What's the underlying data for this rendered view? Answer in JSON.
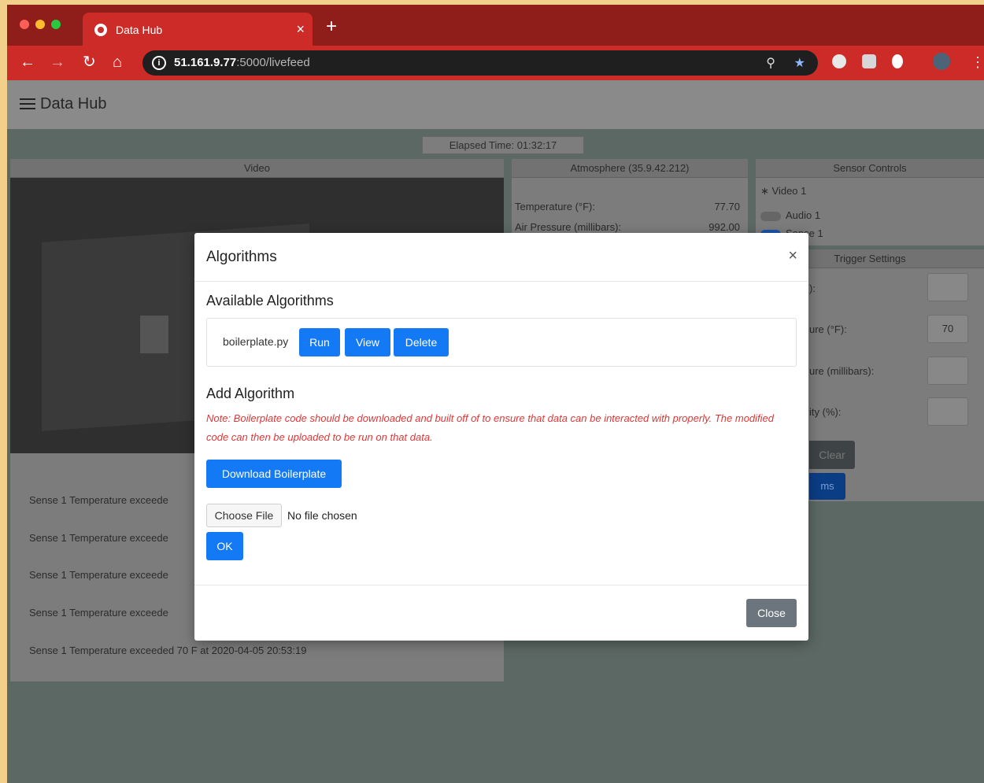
{
  "browser": {
    "tab_title": "Data Hub",
    "tab_close": "×",
    "new_tab": "+",
    "url_host": "51.161.9.77",
    "url_path": ":5000/livefeed",
    "colors": {
      "tabbar": "#8f1d1a",
      "toolbar": "#cc2b27"
    }
  },
  "app": {
    "brand": "Data Hub",
    "elapsed": "Elapsed Time: 01:32:17"
  },
  "video_card": {
    "title": "Video",
    "log": [
      "Sense 1 Temperature exceede",
      "Sense 1 Temperature exceede",
      "Sense 1 Temperature exceede",
      "Sense 1 Temperature exceede",
      "Sense 1 Temperature exceeded 70 F at 2020-04-05 20:53:19"
    ]
  },
  "atmosphere": {
    "title": "Atmosphere (35.9.42.212)",
    "rows": [
      {
        "label": "Temperature (°F):",
        "value": "77.70"
      },
      {
        "label": "Air Pressure (millibars):",
        "value": "992.00"
      }
    ]
  },
  "sensor_controls": {
    "title": "Sensor Controls",
    "items": [
      "Video 1",
      "Audio 1",
      "Sense 1"
    ]
  },
  "trigger_settings": {
    "title": "Trigger Settings",
    "labels": [
      "):",
      "ure (°F):",
      "ure (millibars):",
      "ity (%):"
    ],
    "values": [
      "",
      "70",
      "",
      ""
    ],
    "clear_btn": "Clear",
    "save_btn": "ms"
  },
  "modal": {
    "title": "Algorithms",
    "close_x": "×",
    "available_title": "Available Algorithms",
    "algorithm": {
      "name": "boilerplate.py",
      "run": "Run",
      "view": "View",
      "delete": "Delete"
    },
    "add_title": "Add Algorithm",
    "note": "Note: Boilerplate code should be downloaded and built off of to ensure that data can be interacted with properly. The modified code can then be uploaded to be run on that data.",
    "download_btn": "Download Boilerplate",
    "choose_file": "Choose File",
    "file_status": "No file chosen",
    "ok_btn": "OK",
    "close_btn": "Close",
    "colors": {
      "primary": "#1479f5",
      "note": "#e03636",
      "secondary": "#6c757d"
    }
  }
}
